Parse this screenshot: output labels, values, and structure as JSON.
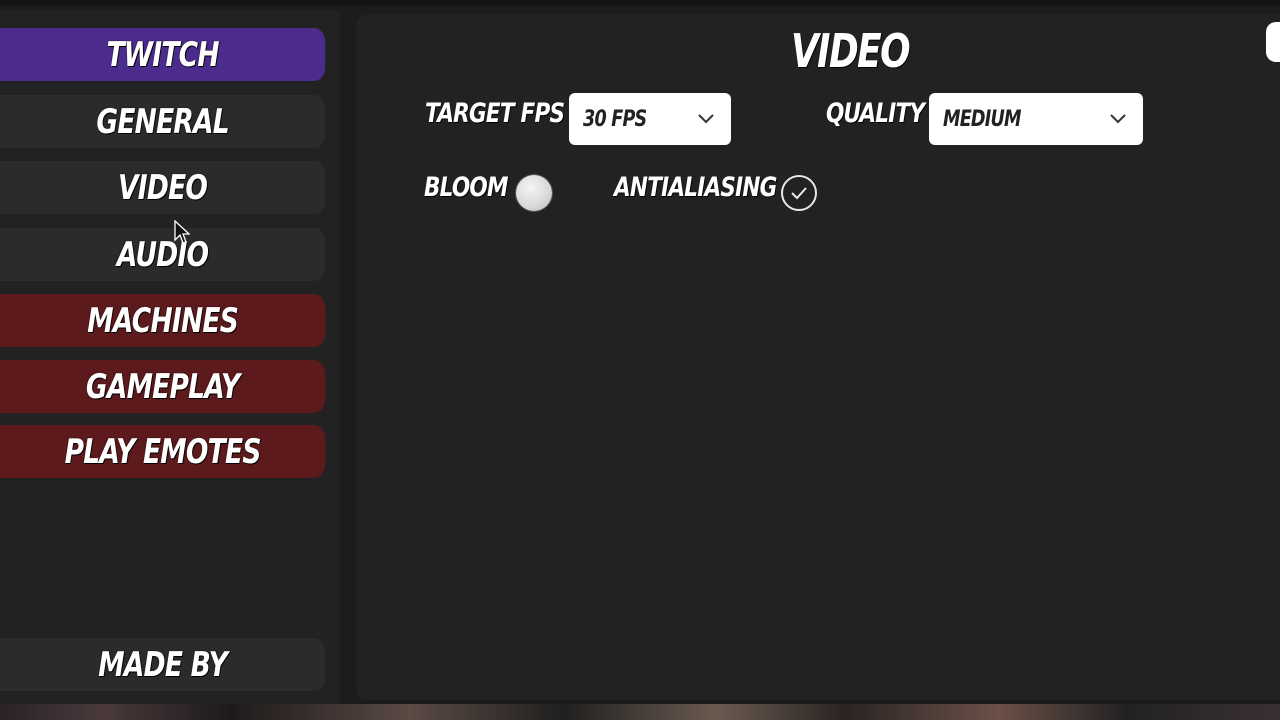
{
  "sidebar": {
    "items": [
      {
        "label": "TWITCH"
      },
      {
        "label": "GENERAL"
      },
      {
        "label": "VIDEO"
      },
      {
        "label": "AUDIO"
      },
      {
        "label": "MACHINES"
      },
      {
        "label": "GAMEPLAY"
      },
      {
        "label": "PLAY EMOTES"
      }
    ],
    "footer": {
      "label": "MADE BY"
    }
  },
  "main": {
    "title": "VIDEO",
    "target_fps": {
      "label": "TARGET FPS",
      "value": "30 FPS"
    },
    "quality": {
      "label": "QUALITY",
      "value": "MEDIUM"
    },
    "bloom": {
      "label": "BLOOM",
      "checked": false
    },
    "antialiasing": {
      "label": "ANTIALIASING",
      "checked": true
    }
  },
  "colors": {
    "twitch_accent": "#4b2b8c",
    "red_accent": "#5c1a1c",
    "panel": "#222222",
    "button": "#2b2b2b"
  },
  "icons": [
    "chevron-down-icon",
    "checkmark-icon",
    "mouse-cursor-icon"
  ]
}
